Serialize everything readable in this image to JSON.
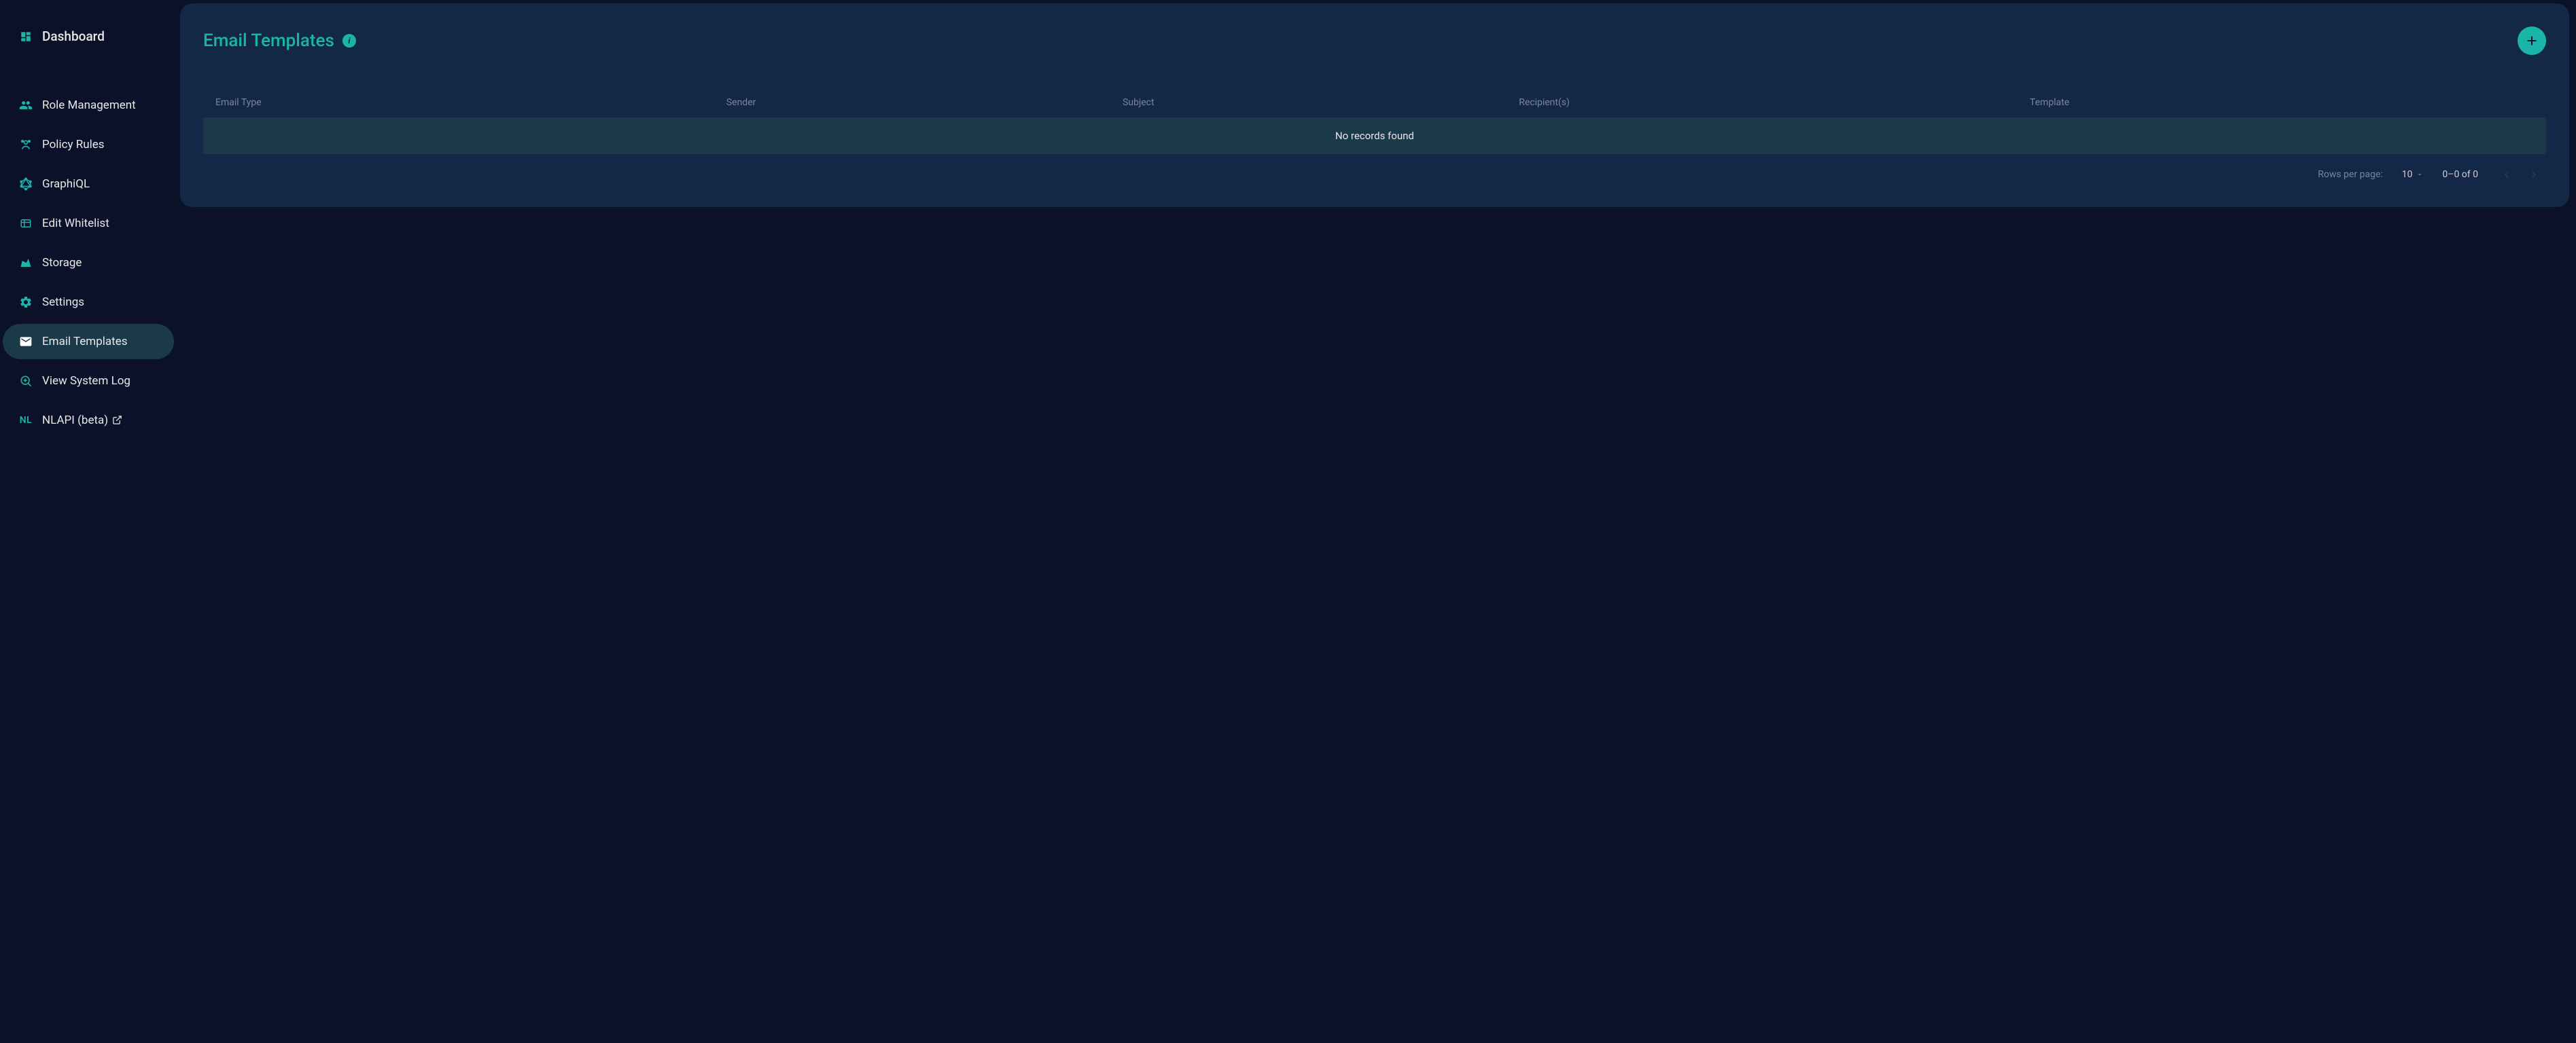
{
  "sidebar": {
    "items": [
      {
        "label": "Dashboard"
      },
      {
        "label": "Role Management"
      },
      {
        "label": "Policy Rules"
      },
      {
        "label": "GraphiQL"
      },
      {
        "label": "Edit Whitelist"
      },
      {
        "label": "Storage"
      },
      {
        "label": "Settings"
      },
      {
        "label": "Email Templates"
      },
      {
        "label": "View System Log"
      },
      {
        "label": "NLAPI (beta)"
      }
    ],
    "nl_prefix": "NL"
  },
  "main": {
    "title": "Email Templates",
    "table": {
      "columns": {
        "type": "Email Type",
        "sender": "Sender",
        "subject": "Subject",
        "recipients": "Recipient(s)",
        "template": "Template"
      },
      "empty": "No records found"
    },
    "pager": {
      "rows_label": "Rows per page:",
      "rows_value": "10",
      "range": "0–0 of 0"
    }
  }
}
